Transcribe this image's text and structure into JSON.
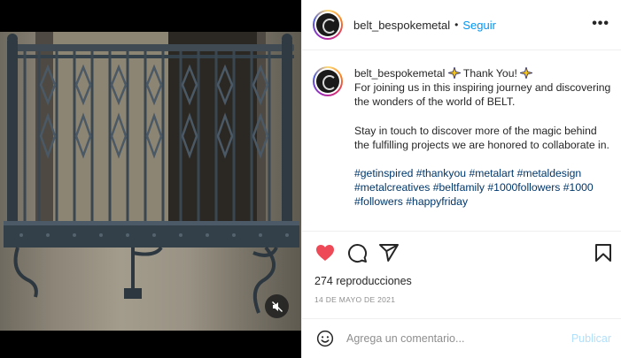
{
  "colors": {
    "accent": "#0095f6",
    "like_red": "#ed4956",
    "hashtag": "#00376b",
    "muted": "#8e8e8e",
    "post_disabled": "#b2dffc"
  },
  "media": {
    "mute_icon": "speaker-muted-icon"
  },
  "header": {
    "username": "belt_bespokemetal",
    "separator": "•",
    "follow_label": "Seguir",
    "more_icon": "more-options-icon",
    "more_label": "•••"
  },
  "caption": {
    "username": "belt_bespokemetal",
    "title": "Thank You!",
    "line1": "For joining us in this inspiring journey and discovering the wonders of the world of BELT.",
    "line2": "Stay in touch to discover more of the magic behind the fulfilling projects we are honored to collaborate in.",
    "hashtags": [
      "#getinspired",
      "#thankyou",
      "#metalart",
      "#metaldesign",
      "#metalcreatives",
      "#beltfamily",
      "#1000followers",
      "#1000",
      "#followers",
      "#happyfriday"
    ]
  },
  "actions": {
    "like_icon": "heart-filled-icon",
    "comment_icon": "comment-icon",
    "share_icon": "share-icon",
    "save_icon": "bookmark-icon"
  },
  "stats": {
    "views": "274 reproducciones",
    "date": "14 DE MAYO DE 2021"
  },
  "comment": {
    "emoji_icon": "emoji-icon",
    "placeholder": "Agrega un comentario...",
    "post_label": "Publicar"
  }
}
